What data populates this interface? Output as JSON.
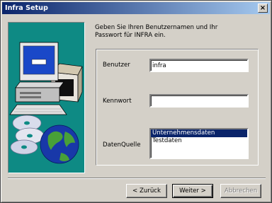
{
  "window": {
    "title": "Infra Setup",
    "close_label": "×"
  },
  "intro": {
    "line1": "Geben Sie Ihren Benutzernamen und Ihr",
    "line2": "Passwort für INFRA ein."
  },
  "form": {
    "user_label": "Benutzer",
    "user_value": "infra",
    "password_label": "Kennwort",
    "password_value": "",
    "datasource_label": "DatenQuelle",
    "datasource_options": [
      "Unternehmensdaten",
      "Testdaten"
    ],
    "datasource_selected": "Unternehmensdaten"
  },
  "buttons": {
    "back": "< Zurück",
    "next": "Weiter >",
    "cancel": "Abbrechen"
  },
  "illustration": {
    "icons": [
      "computer-icon",
      "cd-discs-icon",
      "globe-icon",
      "box-icon"
    ],
    "background": "#0e8a84"
  }
}
